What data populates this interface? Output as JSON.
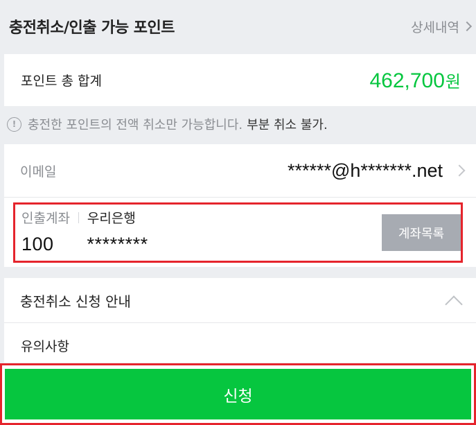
{
  "header": {
    "title": "충전취소/인출 가능 포인트",
    "detail_link": "상세내역"
  },
  "total": {
    "label": "포인트 총 합계",
    "amount": "462,700",
    "unit": "원"
  },
  "notice": {
    "text": "충전한 포인트의 전액 취소만 가능합니다.",
    "strong": "부분 취소 불가.",
    "icon": "info-icon"
  },
  "email": {
    "label": "이메일",
    "value": "******@h*******.net"
  },
  "account": {
    "label": "인출계좌",
    "bank": "우리은행",
    "number": "100      ********",
    "list_button": "계좌목록"
  },
  "guide": {
    "title": "충전취소 신청 안내",
    "caution": "유의사항"
  },
  "submit": {
    "label": "신청"
  },
  "colors": {
    "accent": "#06c63f",
    "highlight_border": "#e5242c",
    "button_gray": "#a7abb2"
  }
}
